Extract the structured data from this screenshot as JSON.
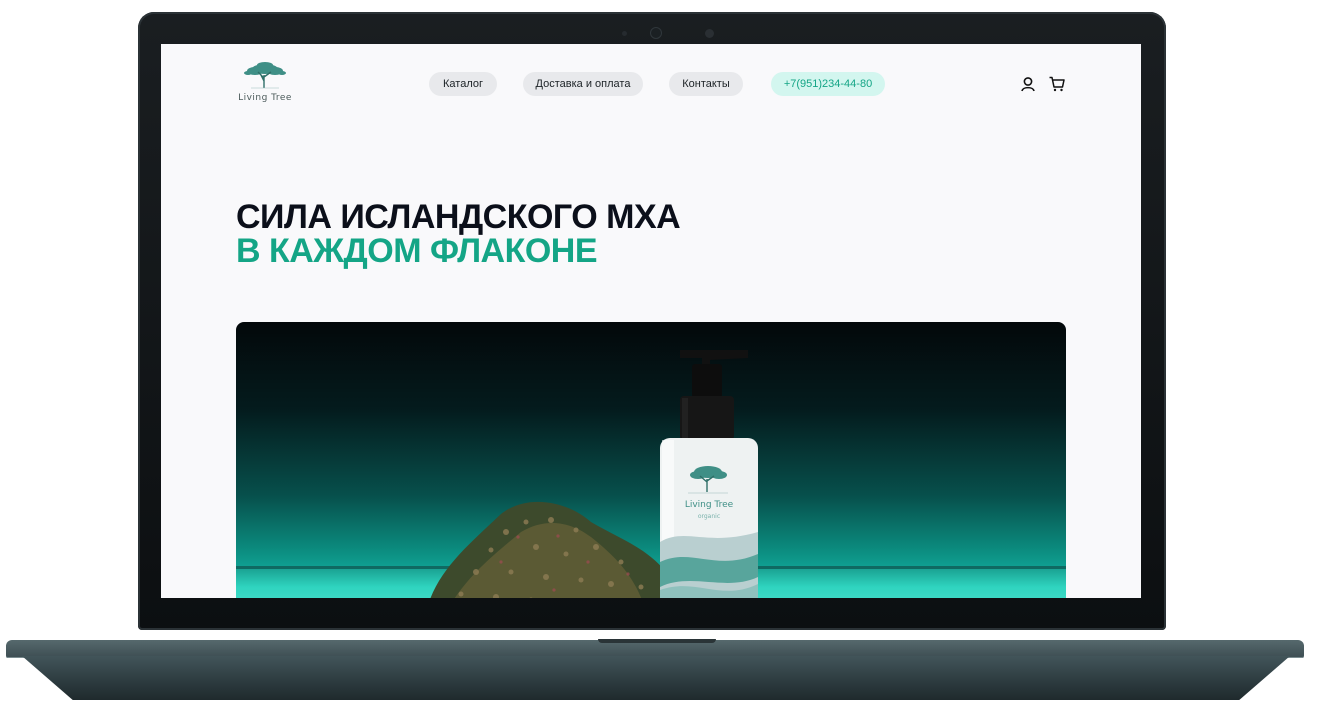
{
  "brand": {
    "logo_text": "Living Tree",
    "accent_color": "#14a586",
    "product_label": "Living Tree",
    "product_sublabel": "organic"
  },
  "nav": {
    "items": [
      {
        "label": "Каталог"
      },
      {
        "label": "Доставка и оплата"
      },
      {
        "label": "Контакты"
      }
    ],
    "phone": "+7(951)234-44-80"
  },
  "header_icons": [
    "user-icon",
    "cart-icon"
  ],
  "hero": {
    "line1": "СИЛА ИСЛАНДСКОГО МХА",
    "line2": "В КАЖДОМ ФЛАКОНЕ"
  }
}
